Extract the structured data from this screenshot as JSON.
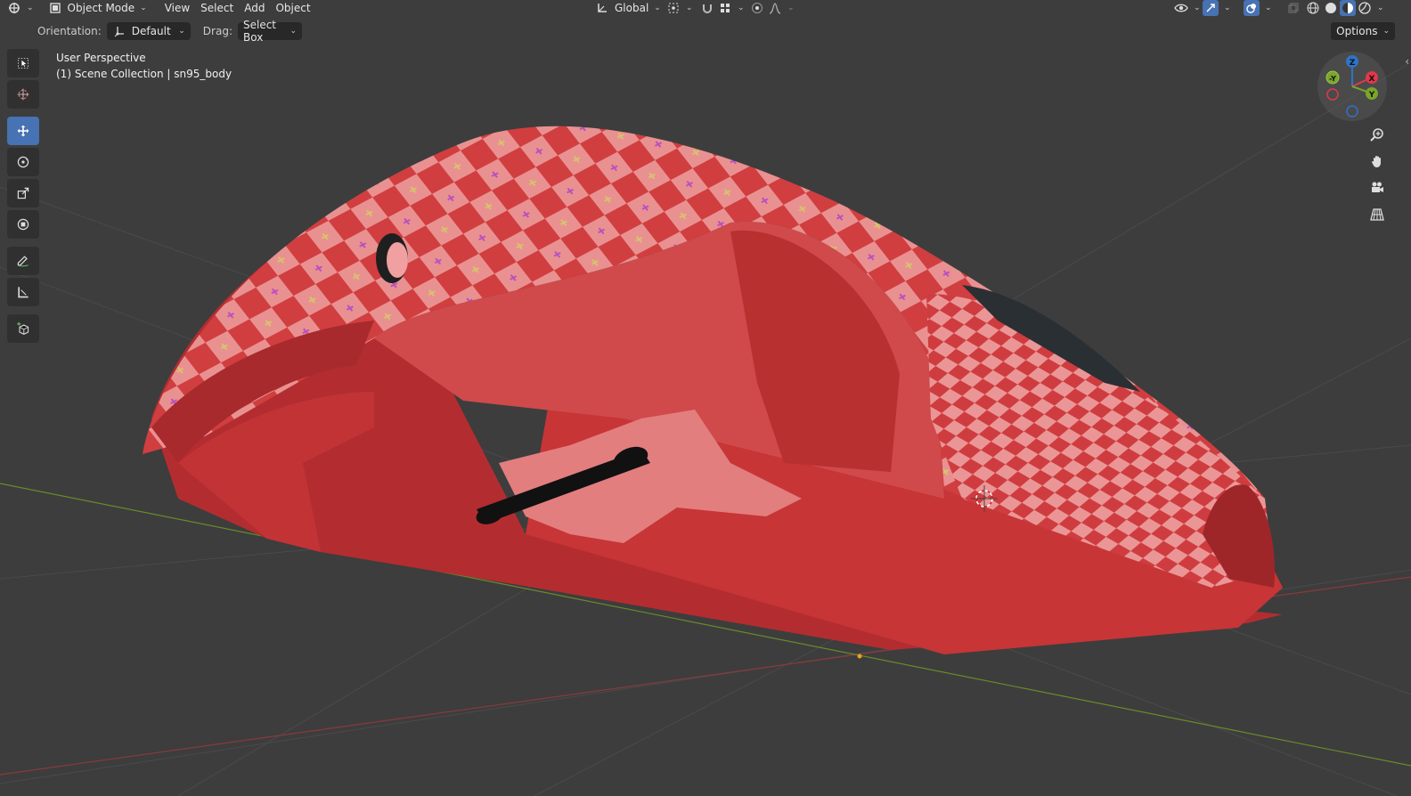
{
  "header": {
    "editor_type_icon": "editor-type-icon",
    "mode": "Object Mode",
    "menus": [
      "View",
      "Select",
      "Add",
      "Object"
    ],
    "transform_orientation": "Global"
  },
  "tool_settings": {
    "orientation_label": "Orientation:",
    "orientation_value": "Default",
    "drag_label": "Drag:",
    "drag_value": "Select Box",
    "options_label": "Options"
  },
  "toolbar": {
    "tools": [
      {
        "name": "select-box-tool",
        "icon": "select-box-icon",
        "active": false
      },
      {
        "name": "cursor-tool",
        "icon": "cursor-icon",
        "active": false
      },
      {
        "name": "move-tool",
        "icon": "move-icon",
        "active": true
      },
      {
        "name": "rotate-tool",
        "icon": "rotate-icon",
        "active": false
      },
      {
        "name": "scale-tool",
        "icon": "scale-icon",
        "active": false
      },
      {
        "name": "transform-tool",
        "icon": "transform-icon",
        "active": false
      },
      {
        "name": "annotate-tool",
        "icon": "annotate-icon",
        "active": false
      },
      {
        "name": "measure-tool",
        "icon": "measure-icon",
        "active": false
      },
      {
        "name": "add-cube-tool",
        "icon": "add-cube-icon",
        "active": false
      }
    ]
  },
  "viewport": {
    "perspective": "User Perspective",
    "collection": "(1) Scene Collection | sn95_body"
  },
  "gizmo": {
    "axis_labels": {
      "z": "Z",
      "x": "X",
      "y": "Y",
      "neg_y": "-Y"
    },
    "colors": {
      "x": "#e0384b",
      "y": "#7aa62b",
      "z": "#2e74c7"
    }
  },
  "navigation": [
    "zoom-icon",
    "pan-hand-icon",
    "camera-icon",
    "grid-view-icon"
  ],
  "colors": {
    "background": "#3d3d3d",
    "active_tool": "#4772b3",
    "model_red": "#c93a3a",
    "model_light": "#e88a8a"
  }
}
